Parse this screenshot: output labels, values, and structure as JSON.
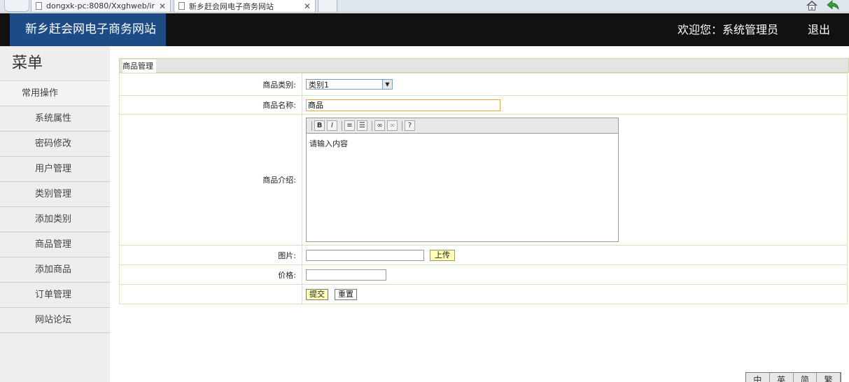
{
  "browser": {
    "tabs": [
      {
        "label": "dongxk-pc:8080/Xxghweb/ir",
        "close": "✕"
      },
      {
        "label": "新乡赶会网电子商务网站",
        "close": "✕"
      }
    ]
  },
  "header": {
    "logo": "新乡赶会网电子商务网站",
    "welcome": "欢迎您：系统管理员",
    "logout": "退出"
  },
  "sidebar": {
    "title": "菜单",
    "section": "常用操作",
    "items": [
      {
        "label": "系统属性"
      },
      {
        "label": "密码修改"
      },
      {
        "label": "用户管理"
      },
      {
        "label": "类别管理"
      },
      {
        "label": "添加类别"
      },
      {
        "label": "商品管理"
      },
      {
        "label": "添加商品"
      },
      {
        "label": "订单管理"
      },
      {
        "label": "网站论坛"
      }
    ]
  },
  "form": {
    "title": "商品管理",
    "category": {
      "label": "商品类别:",
      "value": "类别1"
    },
    "name": {
      "label": "商品名称:",
      "value": "商品"
    },
    "description": {
      "label": "商品介绍:",
      "placeholder_text": "请输入内容"
    },
    "image": {
      "label": "图片:",
      "value": "",
      "upload_label": "上传"
    },
    "price": {
      "label": "价格:",
      "value": ""
    },
    "submit_label": "提交",
    "reset_label": "重置"
  },
  "toolbar_icons": [
    "bold-icon",
    "italic-icon",
    "ordered-list-icon",
    "unordered-list-icon",
    "link-icon",
    "unlink-icon",
    "help-icon"
  ],
  "lang_widget": [
    "中",
    "英",
    "简",
    "繁"
  ],
  "colors": {
    "header_bg": "#111111",
    "logo_bg": "#1d4b86",
    "sidebar_bg": "#eeeeee",
    "button_yellow": "#ffffb8"
  }
}
